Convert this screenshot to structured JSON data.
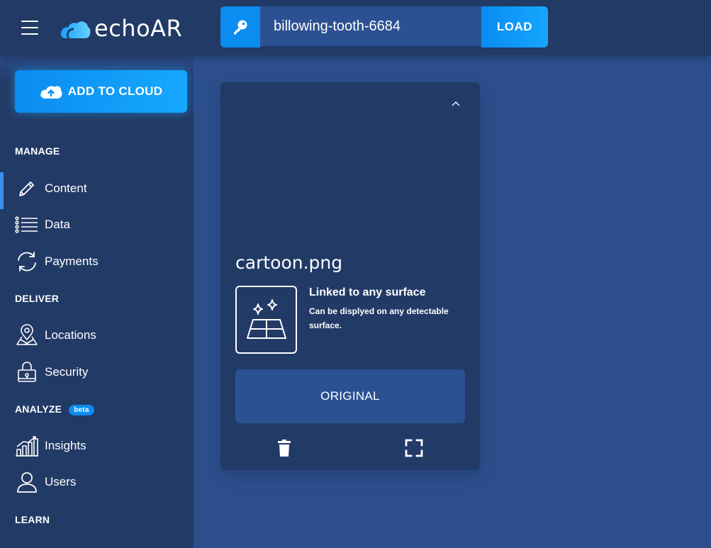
{
  "header": {
    "logo_text": "echoAR",
    "api_key": "billowing-tooth-6684",
    "load_label": "LOAD"
  },
  "sidebar": {
    "add_button_label": "ADD TO CLOUD",
    "sections": [
      {
        "title": "MANAGE",
        "items": [
          "Content",
          "Data",
          "Payments"
        ]
      },
      {
        "title": "DELIVER",
        "items": [
          "Locations",
          "Security"
        ]
      },
      {
        "title": "ANALYZE",
        "badge": "beta",
        "items": [
          "Insights",
          "Users"
        ]
      },
      {
        "title": "LEARN",
        "items": []
      }
    ],
    "active_item": "Content"
  },
  "card": {
    "filename": "cartoon.png",
    "surface_title": "Linked to any surface",
    "surface_desc": "Can be displyed on any detectable surface.",
    "original_label": "ORIGINAL"
  },
  "colors": {
    "background": "#2c4f8c",
    "panel": "#223a66",
    "accent": "#0a8cf0",
    "button_fill": "#2c5193"
  }
}
